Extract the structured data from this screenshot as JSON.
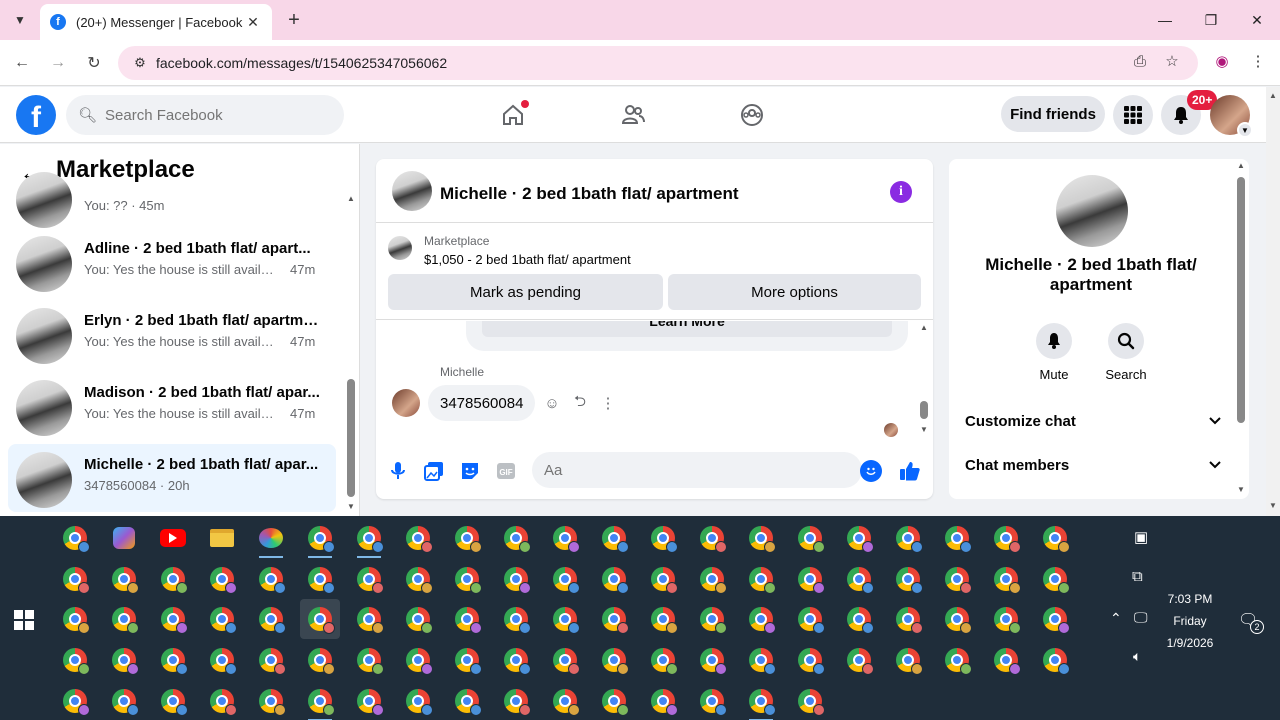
{
  "browser": {
    "tab_title": "(20+) Messenger | Facebook",
    "url": "facebook.com/messages/t/1540625347056062"
  },
  "fb": {
    "search_placeholder": "Search Facebook",
    "find_friends": "Find friends",
    "notif_badge": "20+"
  },
  "left": {
    "title": "Marketplace",
    "conversations": [
      {
        "name": "",
        "snippet": "You: ?? · 45m",
        "time": "",
        "active": false
      },
      {
        "name": "Adline · 2 bed 1bath flat/ apart...",
        "snippet": "You: Yes the house is still availabl...",
        "time": "47m",
        "active": false
      },
      {
        "name": "Erlyn · 2 bed 1bath flat/ apartme...",
        "snippet": "You: Yes the house is still availabl...",
        "time": "47m",
        "active": false
      },
      {
        "name": "Madison · 2 bed 1bath flat/ apar...",
        "snippet": "You: Yes the house is still availabl...",
        "time": "47m",
        "active": false
      },
      {
        "name": "Michelle · 2 bed 1bath flat/ apar...",
        "snippet": "3478560084 · 20h",
        "time": "",
        "active": true
      }
    ]
  },
  "chat": {
    "title": "Michelle · 2 bed 1bath flat/ apartment",
    "marketplace_label": "Marketplace",
    "listing": "$1,050 - 2 bed 1bath flat/ apartment",
    "mark_pending": "Mark as pending",
    "more_options": "More options",
    "card_button": "Learn More",
    "sender": "Michelle",
    "message": "3478560084",
    "composer_placeholder": "Aa"
  },
  "right": {
    "name": "Michelle · 2 bed 1bath flat/ apartment",
    "mute": "Mute",
    "search": "Search",
    "customize": "Customize chat",
    "members": "Chat members"
  },
  "clock": {
    "time": "7:03 PM",
    "day": "Friday",
    "date": "1/9/2026"
  },
  "tray_notif_count": "2"
}
